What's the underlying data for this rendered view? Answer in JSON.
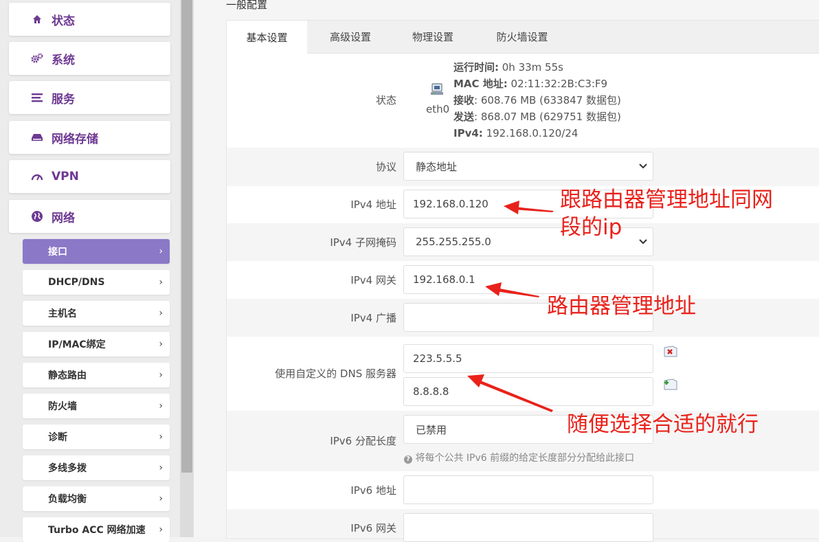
{
  "sidebar": {
    "items": [
      {
        "label": "状态",
        "icon": "home-icon"
      },
      {
        "label": "系统",
        "icon": "gears-icon"
      },
      {
        "label": "服务",
        "icon": "list-icon"
      },
      {
        "label": "网络存储",
        "icon": "drive-icon"
      },
      {
        "label": "VPN",
        "icon": "gauge-icon"
      },
      {
        "label": "网络",
        "icon": "globe-icon"
      }
    ],
    "subitems": [
      {
        "label": "接口",
        "active": true
      },
      {
        "label": "DHCP/DNS"
      },
      {
        "label": "主机名"
      },
      {
        "label": "IP/MAC绑定"
      },
      {
        "label": "静态路由"
      },
      {
        "label": "防火墙"
      },
      {
        "label": "诊断"
      },
      {
        "label": "多线多拨"
      },
      {
        "label": "负载均衡"
      },
      {
        "label": "Turbo ACC 网络加速"
      }
    ],
    "chevron": "›"
  },
  "section_title": "一般配置",
  "tabs": [
    "基本设置",
    "高级设置",
    "物理设置",
    "防火墙设置"
  ],
  "status": {
    "label": "状态",
    "iface": "eth0",
    "uptime_label": "运行时间:",
    "uptime": " 0h 33m 55s",
    "mac_label": "MAC 地址:",
    "mac": " 02:11:32:2B:C3:F9",
    "rx_label": "接收",
    "rx": ": 608.76 MB (633847 数据包)",
    "tx_label": "发送",
    "tx": ": 868.07 MB (629751 数据包)",
    "ipv4_label": "IPv4:",
    "ipv4": " 192.168.0.120/24"
  },
  "form": {
    "protocol_label": "协议",
    "protocol_value": "静态地址",
    "ipv4_addr_label": "IPv4 地址",
    "ipv4_addr_value": "192.168.0.120",
    "netmask_label": "IPv4 子网掩码",
    "netmask_value": "255.255.255.0",
    "gateway_label": "IPv4 网关",
    "gateway_value": "192.168.0.1",
    "broadcast_label": "IPv4 广播",
    "broadcast_value": "",
    "dns_label": "使用自定义的 DNS 服务器",
    "dns1": "223.5.5.5",
    "dns2": "8.8.8.8",
    "ipv6_len_label": "IPv6 分配长度",
    "ipv6_len_value": "已禁用",
    "ipv6_len_hint": "将每个公共 IPv6 前缀的给定长度部分分配给此接口",
    "ipv6_addr_label": "IPv6 地址",
    "ipv6_gw_label": "IPv6 网关"
  },
  "annotations": {
    "a1_line1": "跟路由器管理地址同网",
    "a1_line2": "段的ip",
    "a2": "路由器管理地址",
    "a3": "随便选择合适的就行"
  },
  "colors": {
    "accent": "#6e3a92",
    "active_sub": "#8b78c7",
    "annotation": "#e8221b"
  }
}
